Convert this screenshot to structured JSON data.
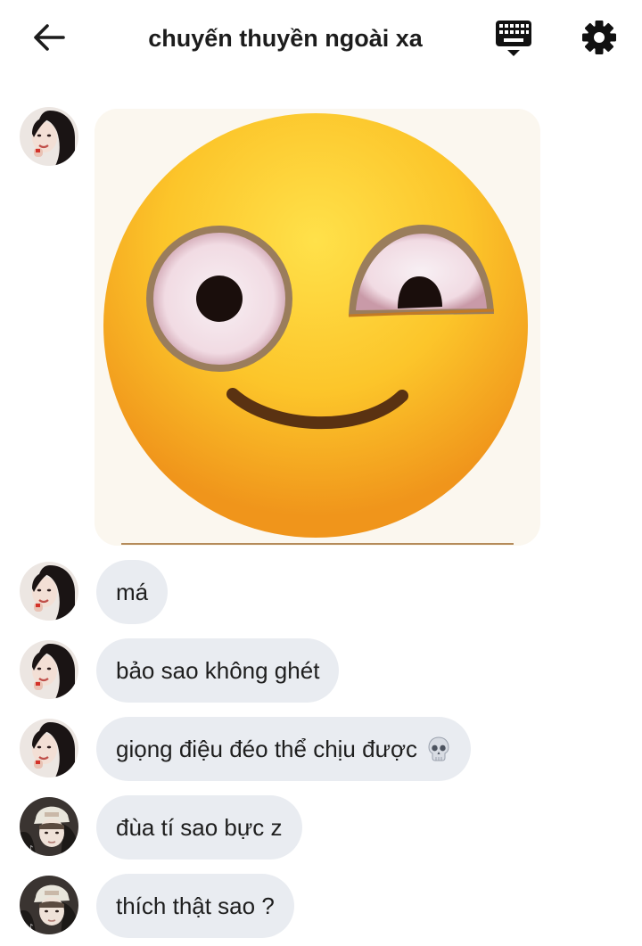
{
  "header": {
    "title": "chuyến thuyền ngoài xa",
    "back_icon": "arrow-left-icon",
    "keyboard_icon": "keyboard-icon",
    "settings_icon": "gear-icon"
  },
  "messages": [
    {
      "type": "sticker",
      "sender": "user-a",
      "sticker_name": "smiling-face-with-mismatched-eyes"
    },
    {
      "type": "text",
      "sender": "user-a",
      "text": "má"
    },
    {
      "type": "text",
      "sender": "user-a",
      "text": "bảo sao không ghét"
    },
    {
      "type": "text",
      "sender": "user-a",
      "text": "giọng điệu đéo thể chịu được",
      "emoji": "skull-icon"
    },
    {
      "type": "text",
      "sender": "user-b",
      "text": "đùa tí sao bực z"
    },
    {
      "type": "text",
      "sender": "user-b",
      "text": "thích thật sao ?"
    }
  ],
  "colors": {
    "bubble": "#e9ecf1",
    "text": "#1e1e1e",
    "background": "#ffffff"
  }
}
